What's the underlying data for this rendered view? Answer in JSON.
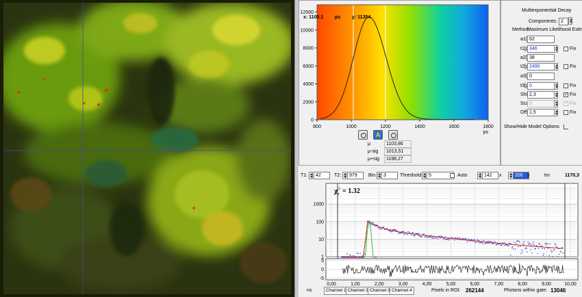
{
  "histogram": {
    "x_readout": "x: 1105.1",
    "x_unit": "ps",
    "y_readout": "y: 11354",
    "x_unit_label": "ps",
    "x_ticks": [
      "800",
      "1000",
      "1200",
      "1400",
      "1600",
      "1800"
    ],
    "y_ticks": [
      "12000",
      "10000",
      "8000",
      "6000",
      "4000",
      "2000",
      "0"
    ],
    "stats": [
      {
        "label": "μ",
        "value": "1103,86"
      },
      {
        "label": "μ-sig",
        "value": "1013,51"
      },
      {
        "label": "μ+sig",
        "value": "1198,27"
      }
    ]
  },
  "decay_panel": {
    "title": "Multiexponential Decay",
    "components_label": "Components:",
    "components_value": "2",
    "method_label": "Method:",
    "method_value": "Maximum Likelihood Estimation",
    "params": [
      {
        "label": "a1[%]",
        "value": "62",
        "blue": false,
        "has_spin": false,
        "has_fix": false
      },
      {
        "label": "t1[ps]",
        "value": "346",
        "blue": true,
        "has_spin": true,
        "has_fix": true,
        "fix_checked": false
      },
      {
        "label": "a2[%]",
        "value": "38",
        "blue": false,
        "has_spin": false,
        "has_fix": false
      },
      {
        "label": "t2[ps]",
        "value": "2490",
        "blue": true,
        "has_spin": true,
        "has_fix": true,
        "fix_checked": false
      },
      {
        "label": "a3[%]",
        "value": "0",
        "blue": false,
        "has_spin": false,
        "has_fix": false
      },
      {
        "label": "t3[ps]",
        "value": "0",
        "blue": true,
        "has_spin": true,
        "has_fix": true,
        "fix_checked": false
      },
      {
        "label": "Shift",
        "value": "2,3",
        "blue": false,
        "has_spin": true,
        "has_fix": true,
        "fix_checked": true
      },
      {
        "label": "Scatter",
        "value": "0",
        "blue": false,
        "has_spin": true,
        "has_fix": true,
        "fix_checked": true,
        "disabled": true
      },
      {
        "label": "Offset",
        "value": "1,5",
        "blue": false,
        "has_spin": true,
        "has_fix": true,
        "fix_checked": false
      }
    ],
    "fix_label": "Fix",
    "show_hide_label": "Show/Hide Model Options"
  },
  "toolbar": {
    "t1_label": "T1:",
    "t1_value": "42",
    "t2_label": "T2:",
    "t2_value": "979",
    "bin_label": "Bin:",
    "bin_value": "3",
    "threshold_label": "Threshold:",
    "threshold_value": "5",
    "auto_label": "Auto",
    "x_value": "142",
    "x_label": "x",
    "y_value": "200",
    "y_label": "y",
    "tm_label": "tm",
    "tm_value": "1170,3"
  },
  "decay": {
    "chi_symbol": "χ",
    "chi_sub": "r",
    "chi_sup": "2",
    "chi_value": "= 1.32",
    "y_ticks": [
      "1000",
      "100",
      "10",
      "1"
    ],
    "res_ticks": [
      "5",
      "0",
      "-5"
    ],
    "x_ticks": [
      "0,00",
      "1,00",
      "2,00",
      "3,00",
      "4,00",
      "5,00",
      "6,00",
      "7,00",
      "8,00",
      "9,00",
      "10,00"
    ],
    "x_unit": "ns"
  },
  "footer": {
    "channels": [
      "Channel 1",
      "Channel 2",
      "Channel 3",
      "Channel 4"
    ],
    "pixels_label": "Pixels in ROI:",
    "pixels_value": "262144",
    "photons_label": "Photons within gate:",
    "photons_value": "13046"
  },
  "colors": {
    "fit_line": "#d02020",
    "irf_line": "#30c040",
    "data_points": "#3030c8"
  }
}
